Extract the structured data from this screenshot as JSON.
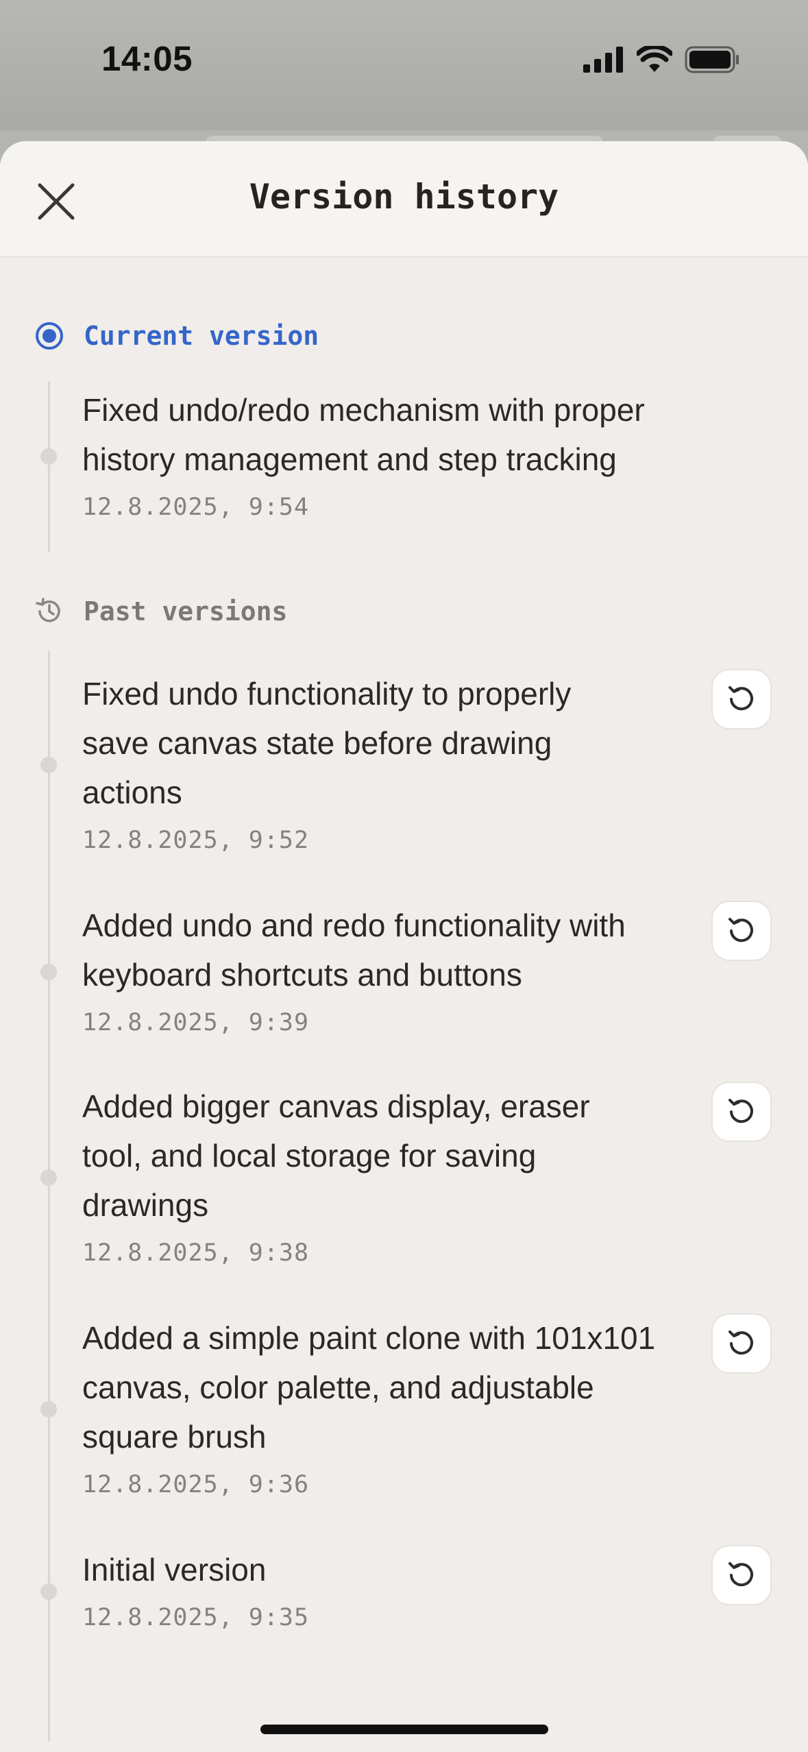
{
  "status_bar": {
    "time": "14:05",
    "icons": [
      "signal-icon",
      "wifi-icon",
      "battery-icon"
    ]
  },
  "header": {
    "title": "Version history",
    "close_icon": "close-icon"
  },
  "current": {
    "label": "Current version",
    "icon": "radio-selected-icon",
    "entry": {
      "text": "Fixed undo/redo mechanism with proper history management and step tracking",
      "date": "12.8.2025, 9:54"
    }
  },
  "past": {
    "label": "Past versions",
    "icon": "history-icon",
    "entries": [
      {
        "text": "Fixed undo functionality to properly save canvas state before drawing actions",
        "date": "12.8.2025, 9:52",
        "action_icon": "restore-icon"
      },
      {
        "text": "Added undo and redo functionality with keyboard shortcuts and buttons",
        "date": "12.8.2025, 9:39",
        "action_icon": "restore-icon"
      },
      {
        "text": "Added bigger canvas display, eraser tool, and local storage for saving drawings",
        "date": "12.8.2025, 9:38",
        "action_icon": "restore-icon"
      },
      {
        "text": "Added a simple paint clone with 101x101 canvas, color palette, and adjustable square brush",
        "date": "12.8.2025, 9:36",
        "action_icon": "restore-icon"
      },
      {
        "text": "Initial version",
        "date": "12.8.2025, 9:35",
        "action_icon": "restore-icon"
      }
    ]
  },
  "colors": {
    "accent": "#3565c9",
    "sheet_background": "#f0edea",
    "header_background": "#f6f4f0",
    "muted_text": "#86817c"
  }
}
